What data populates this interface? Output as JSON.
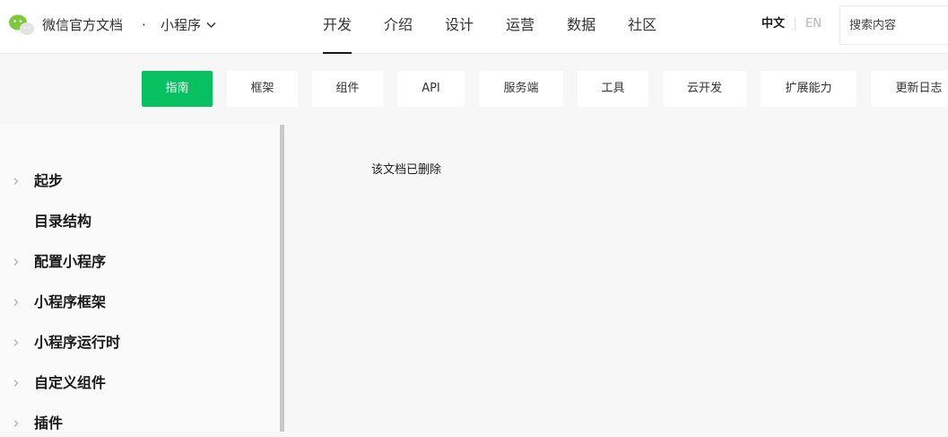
{
  "header": {
    "brand": "微信官方文档",
    "separator": "·",
    "product": "小程序",
    "nav": [
      "开发",
      "介绍",
      "设计",
      "运营",
      "数据",
      "社区"
    ],
    "active_nav": "开发",
    "lang_zh": "中文",
    "lang_en": "EN",
    "search_placeholder": "搜索内容"
  },
  "subnav": {
    "items": [
      "指南",
      "框架",
      "组件",
      "API",
      "服务端",
      "工具",
      "云开发",
      "扩展能力",
      "更新日志"
    ],
    "active": "指南"
  },
  "sidebar": {
    "items": [
      {
        "label": "起步",
        "expandable": true
      },
      {
        "label": "目录结构",
        "expandable": false
      },
      {
        "label": "配置小程序",
        "expandable": true
      },
      {
        "label": "小程序框架",
        "expandable": true
      },
      {
        "label": "小程序运行时",
        "expandable": true
      },
      {
        "label": "自定义组件",
        "expandable": true
      },
      {
        "label": "插件",
        "expandable": true
      }
    ]
  },
  "content": {
    "message": "该文档已删除"
  },
  "colors": {
    "brand_green": "#07c160",
    "background": "#f7f7f7",
    "text": "#1a1a1a"
  }
}
